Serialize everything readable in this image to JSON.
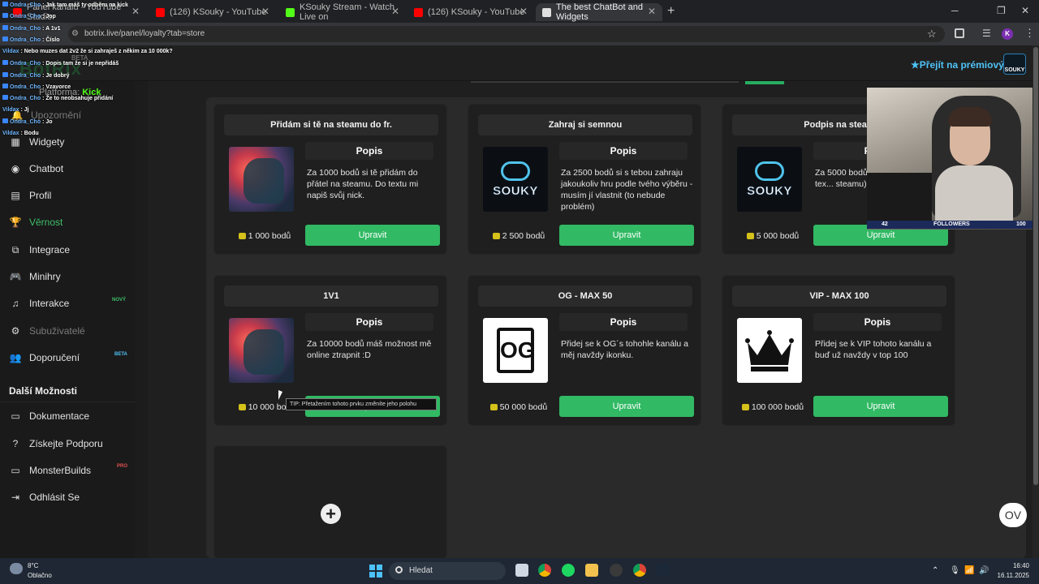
{
  "browser": {
    "tabs": [
      {
        "label": "Panel kanálu - YouTube Studio",
        "color": "#ff0000"
      },
      {
        "label": "(126) KSouky - YouTube",
        "color": "#ff0000"
      },
      {
        "label": "KSouky Stream - Watch Live on",
        "color": "#53fc18"
      },
      {
        "label": "(126) KSouky - YouTube",
        "color": "#ff0000"
      },
      {
        "label": "The best ChatBot and Widgets",
        "color": "#e0e0e0"
      }
    ],
    "url": "botrix.live/panel/loyalty?tab=store",
    "profile_initial": "K"
  },
  "header": {
    "logo": "BotRix",
    "logo_badge": "BETA",
    "platform_label": "Platforma:",
    "platform_value": "Kick",
    "premium_label": "Přejít na prémiový",
    "brand": "SOUKY"
  },
  "sidebar": {
    "items": [
      {
        "label": "Upozornění",
        "icon": "bell-icon"
      },
      {
        "label": "Widgety",
        "icon": "widgets-icon"
      },
      {
        "label": "Chatbot",
        "icon": "robot-icon"
      },
      {
        "label": "Profil",
        "icon": "profile-card-icon"
      },
      {
        "label": "Věrnost",
        "icon": "trophy-icon"
      },
      {
        "label": "Integrace",
        "icon": "integration-icon"
      },
      {
        "label": "Minihry",
        "icon": "gamepad-icon"
      },
      {
        "label": "Interakce",
        "icon": "music-note-icon",
        "badge": "NOVÝ"
      },
      {
        "label": "Subuživatelé",
        "icon": "gear-icon"
      },
      {
        "label": "Doporučení",
        "icon": "referral-icon",
        "badge": "BETA"
      }
    ],
    "more_heading": "Další Možnosti",
    "more_items": [
      {
        "label": "Dokumentace",
        "icon": "document-icon"
      },
      {
        "label": "Získejte Podporu",
        "icon": "help-icon"
      },
      {
        "label": "MonsterBuilds",
        "icon": "monitor-icon",
        "badge": "PRO"
      },
      {
        "label": "Odhlásit Se",
        "icon": "logout-icon"
      }
    ]
  },
  "chat": [
    {
      "user": "Ondra_Cho",
      "msg": "Jak tam máš ty odběru na kick"
    },
    {
      "user": "Ondra_Cho",
      "msg": "Jop"
    },
    {
      "user": "Ondra_Cho",
      "msg": "A 1v1"
    },
    {
      "user": "Ondra_Cho",
      "msg": "Číslo"
    },
    {
      "user": "Vildax",
      "msg": "Nebo muzes dat 2v2 že si zahraješ z někim za 10 000k?"
    },
    {
      "user": "Ondra_Cho",
      "msg": "Dopis tam že si je nepřidáš"
    },
    {
      "user": "Ondra_Cho",
      "msg": "Je dobrý"
    },
    {
      "user": "Ondra_Cho",
      "msg": "Vzavorce"
    },
    {
      "user": "Ondra_Cho",
      "msg": "Že to neobsahuje přidání"
    },
    {
      "user": "Vildax",
      "msg": "Jj"
    },
    {
      "user": "Ondra_Cho",
      "msg": "Jo"
    },
    {
      "user": "Vildax",
      "msg": "Bodu"
    }
  ],
  "store": {
    "desc_heading": "Popis",
    "edit_label": "Upravit",
    "items": [
      {
        "title": "Přidám si tě na steamu do fr.",
        "image": "soldier",
        "desc": "Za 1000 bodů si tě přidám do přátel na steamu. Do textu mi napiš svůj nick.",
        "cost": "1 000 bodů"
      },
      {
        "title": "Zahraj si semnou",
        "image": "souky",
        "desc": "Za 2500 bodů si s tebou zahraju jakoukoliv hru podle tvého výběru - musím jí vlastnit (to nebude problém)",
        "cost": "2 500 bodů"
      },
      {
        "title": "Podpis na steam",
        "image": "souky",
        "desc": "Za 5000 bodů si ... steam. (Do tex... steamu)",
        "cost": "5 000 bodů"
      },
      {
        "title": "1V1",
        "image": "soldier",
        "desc": "Za 10000 bodů máš možnost mě online ztrapnit :D",
        "cost": "10 000 bod"
      },
      {
        "title": "OG - MAX 50",
        "image": "og",
        "desc": "Přidej se k OG´s tohohle kanálu a měj navždy ikonku.",
        "cost": "50 000 bodů"
      },
      {
        "title": "VIP - MAX 100",
        "image": "crown",
        "desc": "Přidej se k VIP tohoto kanálu a buď už navždy v top 100",
        "cost": "100 000 bodů"
      }
    ],
    "tooltip": "TIP: Přetažením tohoto prvku změníte jeho polohu"
  },
  "webcam": {
    "left_count": "42",
    "label": "FOLLOWERS",
    "right_count": "100"
  },
  "taskbar": {
    "temp": "8°C",
    "weather": "Oblačno",
    "search": "Hledat",
    "time": "16:40",
    "date": "16.11.2025"
  },
  "overlay_bubble": "OV"
}
